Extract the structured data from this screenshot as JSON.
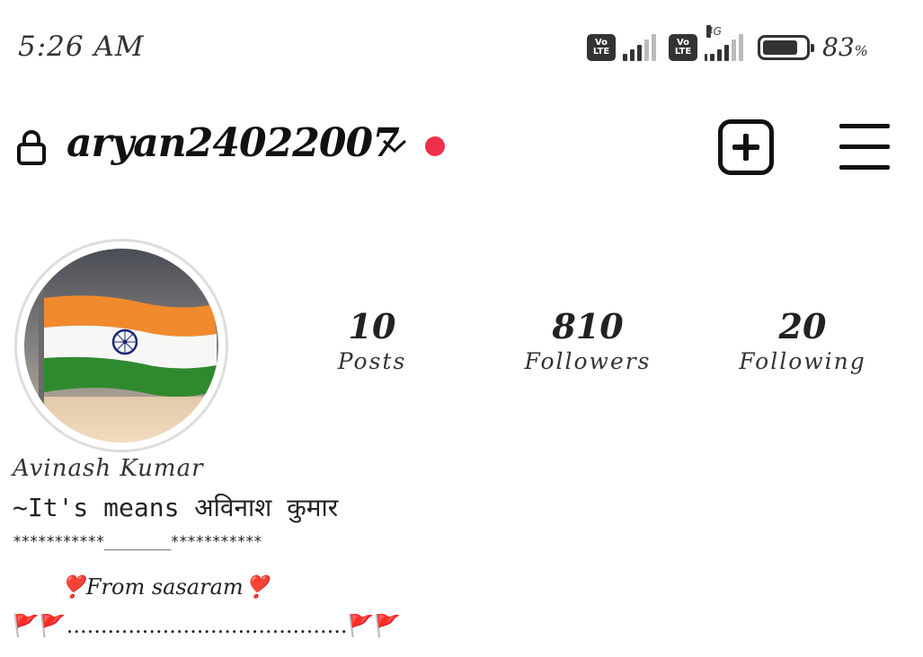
{
  "status_bar": {
    "time": "5:26 AM",
    "volte1": "Vo LTE",
    "volte2": "Vo LTE",
    "network_type": "4G",
    "battery_percent": "83",
    "battery_unit": "%",
    "battery_level": 0.83
  },
  "header": {
    "username": "aryan24022007",
    "lock_icon": "lock-icon",
    "dropdown_icon": "chevron-down-icon",
    "notification_dot_color": "#f0304a",
    "create_icon": "plus-square-icon",
    "menu_icon": "hamburger-menu-icon"
  },
  "profile": {
    "avatar": "indian-flag-profile-picture",
    "stats": [
      {
        "value": "10",
        "label": "Posts"
      },
      {
        "value": "810",
        "label": "Followers"
      },
      {
        "value": "20",
        "label": "Following"
      }
    ]
  },
  "bio": {
    "name": "Avinash Kumar",
    "line1": "~It's means अविनाश कुमार",
    "line2": "***********________***********",
    "line3": "❣️From sasaram❣️",
    "line4": "🚩🚩.........................................🚩🚩"
  }
}
